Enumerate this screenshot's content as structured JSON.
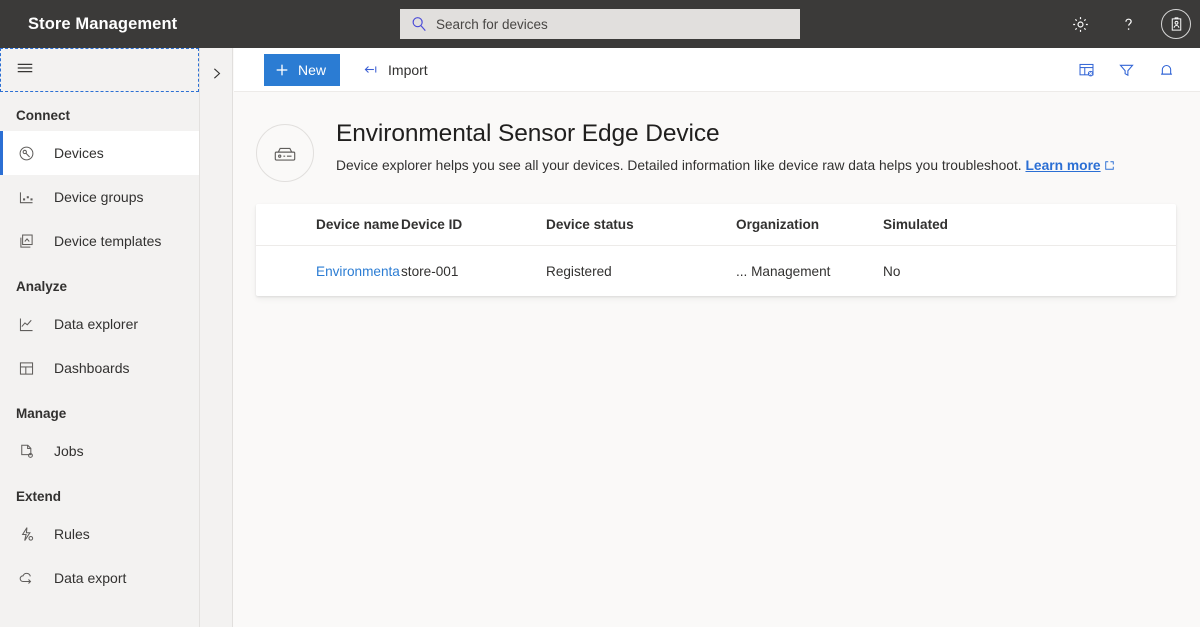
{
  "header": {
    "brand": "Store Management",
    "search": {
      "placeholder": "Search for devices",
      "icon": "search-icon"
    },
    "icons": [
      {
        "name": "gear-icon",
        "label": "Settings"
      },
      {
        "name": "help-icon",
        "label": "?"
      },
      {
        "name": "account-badge-icon",
        "label": "Account"
      }
    ]
  },
  "sidebar": {
    "menu_icon": "hamburger-icon",
    "expander_icon": "chevron-right-icon",
    "sections": [
      {
        "title": "Connect",
        "items": [
          {
            "label": "Devices",
            "icon": "devices-icon",
            "selected": true
          },
          {
            "label": "Device groups",
            "icon": "device-groups-icon",
            "selected": false
          },
          {
            "label": "Device templates",
            "icon": "device-templates-icon",
            "selected": false
          }
        ]
      },
      {
        "title": "Analyze",
        "items": [
          {
            "label": "Data explorer",
            "icon": "data-explorer-icon",
            "selected": false
          },
          {
            "label": "Dashboards",
            "icon": "dashboards-icon",
            "selected": false
          }
        ]
      },
      {
        "title": "Manage",
        "items": [
          {
            "label": "Jobs",
            "icon": "jobs-icon",
            "selected": false
          }
        ]
      },
      {
        "title": "Extend",
        "items": [
          {
            "label": "Rules",
            "icon": "rules-icon",
            "selected": false
          },
          {
            "label": "Data export",
            "icon": "data-export-icon",
            "selected": false
          }
        ]
      }
    ]
  },
  "commandbar": {
    "new_label": "New",
    "import_label": "Import",
    "right_icons": [
      {
        "name": "column-options-icon"
      },
      {
        "name": "filter-icon"
      },
      {
        "name": "bell-icon"
      }
    ]
  },
  "page": {
    "icon": "edge-device-icon",
    "title": "Environmental Sensor Edge Device",
    "subtitle": "Device explorer helps you see all your devices. Detailed information like device raw data helps you troubleshoot.",
    "learn_more": "Learn more"
  },
  "table": {
    "columns": [
      "Device name",
      "Device ID",
      "Device status",
      "Organization",
      "Simulated"
    ],
    "rows": [
      {
        "device_name": "Environmenta...",
        "device_id": "store-001",
        "device_status": "Registered",
        "organization": "... Management",
        "simulated": "No"
      }
    ]
  },
  "colors": {
    "header_bg": "#3b3a39",
    "accent_blue": "#2b7cd3",
    "sidebar_bg": "#f3f2f1",
    "page_bg": "#faf9f8"
  }
}
